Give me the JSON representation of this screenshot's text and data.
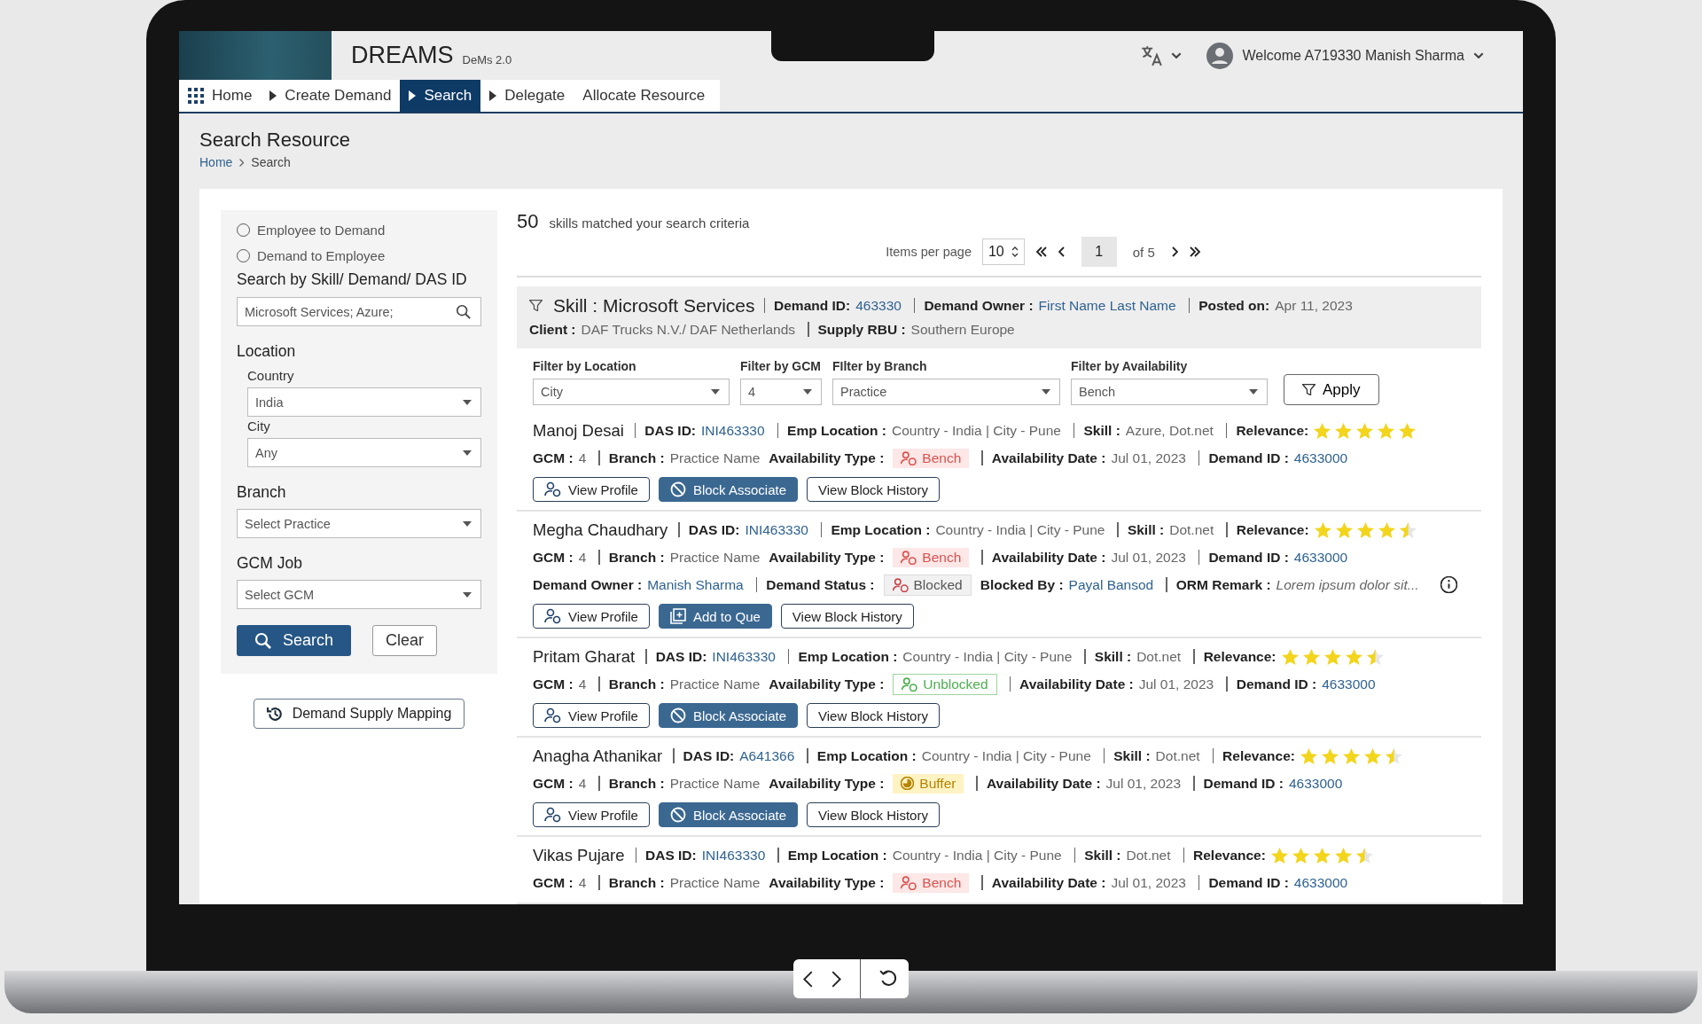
{
  "app": {
    "name": "DREAMS",
    "version": "DeMs 2.0",
    "welcome": "Welcome A719330 Manish Sharma"
  },
  "nav": [
    {
      "label": "Home",
      "selected": false
    },
    {
      "label": "Create Demand",
      "selected": false
    },
    {
      "label": "Search",
      "selected": true
    },
    {
      "label": "Delegate",
      "selected": false
    },
    {
      "label": "Allocate Resource",
      "selected": false
    }
  ],
  "page": {
    "title": "Search Resource",
    "breadcrumb": [
      "Home",
      "Search"
    ]
  },
  "search_panel": {
    "modes": [
      {
        "label": "Employee to Demand",
        "selected": false
      },
      {
        "label": "Demand to Employee",
        "selected": false
      }
    ],
    "search_label": "Search by Skill/ Demand/ DAS ID",
    "search_value": "Microsoft Services; Azure;",
    "location_label": "Location",
    "location_fields": [
      {
        "label": "Country",
        "value": "India"
      },
      {
        "label": "City",
        "value": "Any"
      }
    ],
    "groups": [
      {
        "label": "Branch",
        "value": "Select Practice"
      },
      {
        "label": "GCM Job",
        "value": "Select GCM"
      }
    ],
    "search_button": "Search",
    "clear_button": "Clear",
    "mapping_button": "Demand Supply Mapping"
  },
  "results": {
    "count": "50",
    "count_text": "skills matched your search criteria",
    "items_per_page_label": "Items per page",
    "items_per_page": "10",
    "page": "1",
    "of_pages": "of 5",
    "skill_header": [
      [
        {
          "kind": "skill",
          "text": "Skill : Microsoft Services"
        },
        {
          "kind": "field",
          "label": "Demand ID:",
          "value": "463330",
          "link": true,
          "sep": true
        },
        {
          "kind": "field",
          "label": "Demand Owner :",
          "value": "First Name Last Name",
          "link": true,
          "sep": true
        },
        {
          "kind": "field",
          "label": "Posted on:",
          "value": "Apr 11, 2023",
          "link": false,
          "sep": true
        }
      ],
      [
        {
          "kind": "field",
          "label": "Client :",
          "value": "DAF Trucks N.V./ DAF Netherlands",
          "link": false,
          "sep": false
        },
        {
          "kind": "field",
          "label": "Supply RBU :",
          "value": "Southern Europe",
          "link": false,
          "sep": true
        }
      ]
    ],
    "filters": [
      {
        "label": "Filter by Location",
        "value": "City"
      },
      {
        "label": "Filter by GCM",
        "value": "4"
      },
      {
        "label": "FIlter by Branch",
        "value": "Practice"
      },
      {
        "label": "Filter by Availability",
        "value": "Bench"
      }
    ],
    "apply_button": "Apply",
    "rows": [
      {
        "lines": [
          [
            {
              "kind": "name",
              "text": "Manoj Desai"
            },
            {
              "kind": "field",
              "label": "DAS ID:",
              "value": "INI463330",
              "link": true,
              "sep": true
            },
            {
              "kind": "field",
              "label": "Emp Location :",
              "value": "Country - India | City - Pune",
              "link": false,
              "sep": true
            },
            {
              "kind": "field",
              "label": "Skill :",
              "value": "Azure, Dot.net",
              "link": false,
              "sep": true
            },
            {
              "kind": "stars",
              "label": "Relevance:",
              "stars": 5,
              "sep": true
            }
          ],
          [
            {
              "kind": "field",
              "label": "GCM :",
              "value": "4",
              "link": false,
              "sep": false
            },
            {
              "kind": "field",
              "label": "Branch :",
              "value": "Practice Name",
              "link": false,
              "sep": true
            },
            {
              "kind": "chip",
              "label": "Availability Type :",
              "tag": {
                "kind": "bench",
                "text": "Bench"
              },
              "sep": false
            },
            {
              "kind": "field",
              "label": "Availability Date :",
              "value": "Jul 01, 2023",
              "link": false,
              "sep": true
            },
            {
              "kind": "field",
              "label": "Demand ID :",
              "value": "4633000",
              "link": true,
              "sep": true
            }
          ]
        ],
        "buttons": [
          {
            "label": "View Profile",
            "kind": "profile"
          },
          {
            "label": "Block Associate",
            "kind": "block"
          },
          {
            "label": "View Block History",
            "kind": "plain"
          }
        ]
      },
      {
        "lines": [
          [
            {
              "kind": "name",
              "text": "Megha Chaudhary"
            },
            {
              "kind": "field",
              "label": "DAS ID:",
              "value": "INI463330",
              "link": true,
              "sep": true
            },
            {
              "kind": "field",
              "label": "Emp Location :",
              "value": "Country - India | City - Pune",
              "link": false,
              "sep": true
            },
            {
              "kind": "field",
              "label": "Skill :",
              "value": "Dot.net",
              "link": false,
              "sep": true
            },
            {
              "kind": "stars",
              "label": "Relevance:",
              "stars": 4.5,
              "sep": true
            }
          ],
          [
            {
              "kind": "field",
              "label": "GCM :",
              "value": "4",
              "link": false,
              "sep": false
            },
            {
              "kind": "field",
              "label": "Branch :",
              "value": "Practice Name",
              "link": false,
              "sep": true
            },
            {
              "kind": "chip",
              "label": "Availability Type :",
              "tag": {
                "kind": "bench",
                "text": "Bench"
              },
              "sep": false
            },
            {
              "kind": "field",
              "label": "Availability Date :",
              "value": "Jul 01, 2023",
              "link": false,
              "sep": true
            },
            {
              "kind": "field",
              "label": "Demand ID :",
              "value": "4633000",
              "link": true,
              "sep": true
            }
          ],
          [
            {
              "kind": "field",
              "label": "Demand Owner :",
              "value": "Manish Sharma",
              "link": true,
              "sep": false
            },
            {
              "kind": "chip",
              "label": "Demand Status :",
              "tag": {
                "kind": "blocked",
                "text": "Blocked"
              },
              "sep": true
            },
            {
              "kind": "field",
              "label": "Blocked By :",
              "value": "Payal Bansod",
              "link": true,
              "sep": false
            },
            {
              "kind": "remark",
              "label": "ORM Remark :",
              "value": "Lorem ipsum dolor sit...",
              "sep": true
            },
            {
              "kind": "info"
            }
          ]
        ],
        "buttons": [
          {
            "label": "View Profile",
            "kind": "profile"
          },
          {
            "label": "Add to Que",
            "kind": "add"
          },
          {
            "label": "View Block History",
            "kind": "plain"
          }
        ]
      },
      {
        "lines": [
          [
            {
              "kind": "name",
              "text": "Pritam Gharat"
            },
            {
              "kind": "field",
              "label": "DAS ID:",
              "value": "INI463330",
              "link": true,
              "sep": true
            },
            {
              "kind": "field",
              "label": "Emp Location :",
              "value": "Country - India | City - Pune",
              "link": false,
              "sep": true
            },
            {
              "kind": "field",
              "label": "Skill :",
              "value": "Dot.net",
              "link": false,
              "sep": true
            },
            {
              "kind": "stars",
              "label": "Relevance:",
              "stars": 4.5,
              "sep": true
            }
          ],
          [
            {
              "kind": "field",
              "label": "GCM :",
              "value": "4",
              "link": false,
              "sep": false
            },
            {
              "kind": "field",
              "label": "Branch :",
              "value": "Practice Name",
              "link": false,
              "sep": true
            },
            {
              "kind": "chip",
              "label": "Availability Type :",
              "tag": {
                "kind": "unblocked",
                "text": "Unblocked"
              },
              "sep": false
            },
            {
              "kind": "field",
              "label": "Availability Date :",
              "value": "Jul 01, 2023",
              "link": false,
              "sep": true
            },
            {
              "kind": "field",
              "label": "Demand ID :",
              "value": "4633000",
              "link": true,
              "sep": true
            }
          ]
        ],
        "buttons": [
          {
            "label": "View Profile",
            "kind": "profile"
          },
          {
            "label": "Block Associate",
            "kind": "block"
          },
          {
            "label": "View Block History",
            "kind": "plain"
          }
        ]
      },
      {
        "lines": [
          [
            {
              "kind": "name",
              "text": "Anagha Athanikar"
            },
            {
              "kind": "field",
              "label": "DAS ID:",
              "value": "A641366",
              "link": true,
              "sep": true
            },
            {
              "kind": "field",
              "label": "Emp Location :",
              "value": "Country - India | City - Pune",
              "link": false,
              "sep": true
            },
            {
              "kind": "field",
              "label": "Skill :",
              "value": "Dot.net",
              "link": false,
              "sep": true
            },
            {
              "kind": "stars",
              "label": "Relevance:",
              "stars": 4.5,
              "sep": true
            }
          ],
          [
            {
              "kind": "field",
              "label": "GCM :",
              "value": "4",
              "link": false,
              "sep": false
            },
            {
              "kind": "field",
              "label": "Branch :",
              "value": "Practice Name",
              "link": false,
              "sep": true
            },
            {
              "kind": "chip",
              "label": "Availability Type :",
              "tag": {
                "kind": "buffer",
                "text": "Buffer"
              },
              "sep": false
            },
            {
              "kind": "field",
              "label": "Availability Date :",
              "value": "Jul 01, 2023",
              "link": false,
              "sep": true
            },
            {
              "kind": "field",
              "label": "Demand ID :",
              "value": "4633000",
              "link": true,
              "sep": true
            }
          ]
        ],
        "buttons": [
          {
            "label": "View Profile",
            "kind": "profile"
          },
          {
            "label": "Block Associate",
            "kind": "block"
          },
          {
            "label": "View Block History",
            "kind": "plain"
          }
        ]
      },
      {
        "lines": [
          [
            {
              "kind": "name",
              "text": "Vikas Pujare"
            },
            {
              "kind": "field",
              "label": "DAS ID:",
              "value": "INI463330",
              "link": true,
              "sep": true
            },
            {
              "kind": "field",
              "label": "Emp Location :",
              "value": "Country - India | City - Pune",
              "link": false,
              "sep": true
            },
            {
              "kind": "field",
              "label": "Skill :",
              "value": "Dot.net",
              "link": false,
              "sep": true
            },
            {
              "kind": "stars",
              "label": "Relevance:",
              "stars": 4.5,
              "sep": true
            }
          ],
          [
            {
              "kind": "field",
              "label": "GCM :",
              "value": "4",
              "link": false,
              "sep": false
            },
            {
              "kind": "field",
              "label": "Branch :",
              "value": "Practice Name",
              "link": false,
              "sep": true
            },
            {
              "kind": "chip",
              "label": "Availability Type :",
              "tag": {
                "kind": "bench",
                "text": "Bench"
              },
              "sep": false
            },
            {
              "kind": "field",
              "label": "Availability Date :",
              "value": "Jul 01, 2023",
              "link": false,
              "sep": true
            },
            {
              "kind": "field",
              "label": "Demand ID :",
              "value": "4633000",
              "link": true,
              "sep": true
            }
          ]
        ],
        "buttons": []
      }
    ]
  }
}
